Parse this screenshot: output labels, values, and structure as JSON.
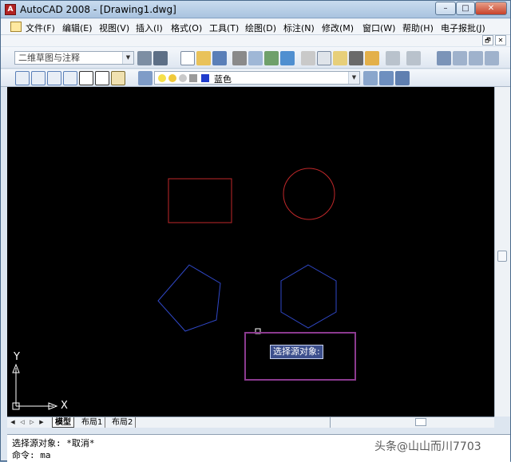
{
  "window": {
    "title": "AutoCAD 2008 - [Drawing1.dwg]",
    "app_icon_glyph": "A",
    "controls": [
      "–",
      "□",
      "✕"
    ]
  },
  "menus": [
    "文件(F)",
    "编辑(E)",
    "视图(V)",
    "插入(I)",
    "格式(O)",
    "工具(T)",
    "绘图(D)",
    "标注(N)",
    "修改(M)",
    "窗口(W)",
    "帮助(H)",
    "电子报批(J)"
  ],
  "mdi_controls": [
    "🗗",
    "✕"
  ],
  "toolbar": {
    "workspace_value": "二维草图与注释",
    "layer_value": "蓝色"
  },
  "canvas": {
    "tooltip": "选择源对象:",
    "ucs_x": "X",
    "ucs_y": "Y",
    "shape_colors": {
      "red": "#c0282a",
      "blue": "#3048c8"
    }
  },
  "layout_tabs": [
    "模型",
    "布局1",
    "布局2"
  ],
  "command": {
    "line1": "选择源对象: *取消*",
    "line2": "命令: ma"
  },
  "watermark": "头条@山山而川7703"
}
